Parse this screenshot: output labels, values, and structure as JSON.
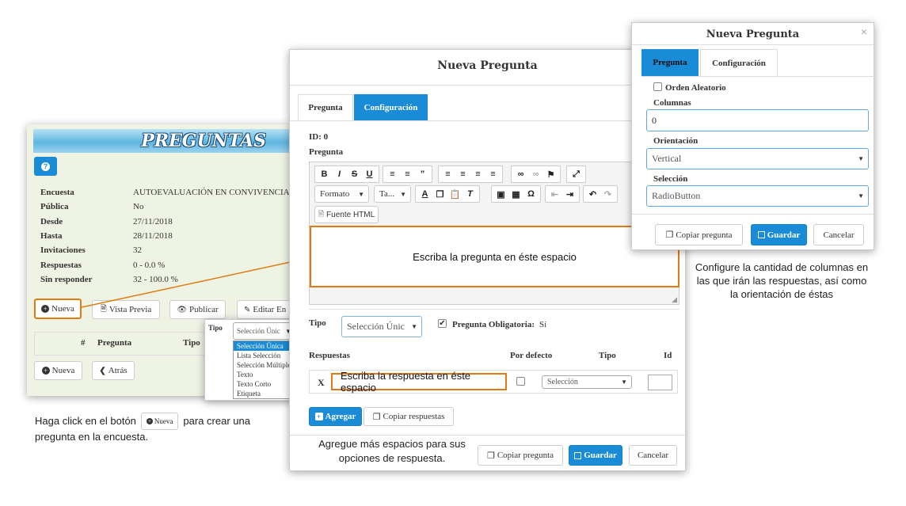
{
  "survey_panel": {
    "title": "PREGUNTAS",
    "help_label": "?",
    "rows": [
      {
        "label": "Encuesta",
        "value": "AUTOEVALUACIÓN EN CONVIVENCIA"
      },
      {
        "label": "Pública",
        "value": "No"
      },
      {
        "label": "Desde",
        "value": "27/11/2018"
      },
      {
        "label": "Hasta",
        "value": "28/11/2018"
      },
      {
        "label": "Invitaciones",
        "value": "32"
      },
      {
        "label": "Respuestas",
        "value": "0  -  0.0 %"
      },
      {
        "label": "Sin responder",
        "value": "32  -  100.0 %"
      }
    ],
    "buttons": {
      "nueva": "Nueva",
      "vista_previa": "Vista Previa",
      "publicar": "Publicar",
      "editar": "Editar En"
    },
    "table_headers": {
      "num": "#",
      "pregunta": "Pregunta",
      "tipo": "Tipo"
    },
    "bottom_buttons": {
      "nueva": "Nueva",
      "atras": "Atrás"
    }
  },
  "tipo_popup": {
    "label": "Tipo",
    "selected": "Selección Únic",
    "options": [
      "Selección Única",
      "Lista Selección",
      "Selección Múltiple",
      "Texto",
      "Texto Corto",
      "Etiqueta"
    ]
  },
  "caption_left": {
    "before": "Haga click en el botón",
    "button": "Nueva",
    "after1": "para crear una",
    "after2": "pregunta en la encuesta."
  },
  "main_modal": {
    "title": "Nueva Pregunta",
    "tabs": [
      "Pregunta",
      "Configuración"
    ],
    "id_label": "ID: 0",
    "pregunta_label": "Pregunta",
    "toolbar": {
      "formato": "Formato",
      "tamano": "Ta...",
      "fuente_html": "Fuente HTML"
    },
    "editor_text": "Escriba la pregunta en éste espacio",
    "tipo_label": "Tipo",
    "tipo_value": "Selección Únic",
    "obligatoria_label": "Pregunta Obligatoria:",
    "obligatoria_value": "Sí",
    "headers": {
      "respuestas": "Respuestas",
      "por_defecto": "Por defecto",
      "tipo": "Tipo",
      "id": "Id"
    },
    "answer_remove": "X",
    "answer_text": "Escriba la respuesta en éste espacio",
    "answer_type": "Selección",
    "buttons": {
      "agregar": "Agregar",
      "copiar_respuestas": "Copiar respuestas",
      "copiar_pregunta": "Copiar pregunta",
      "guardar": "Guardar",
      "cancelar": "Cancelar"
    }
  },
  "caption_middle": {
    "line1": "Agregue más espacios para sus",
    "line2": "opciones de respuesta."
  },
  "config_modal": {
    "title": "Nueva Pregunta",
    "close": "×",
    "tabs": [
      "Pregunta",
      "Configuración"
    ],
    "orden_label": "Orden Aleatorio",
    "columnas_label": "Columnas",
    "columnas_value": "0",
    "orientacion_label": "Orientación",
    "orientacion_value": "Vertical",
    "seleccion_label": "Selección",
    "seleccion_value": "RadioButton",
    "buttons": {
      "copiar_pregunta": "Copiar pregunta",
      "guardar": "Guardar",
      "cancelar": "Cancelar"
    }
  },
  "caption_right": {
    "line1": "Configure la cantidad de columnas en",
    "line2": "las que irán las respuestas, así como",
    "line3": "la orientación de éstas"
  },
  "colors": {
    "primary": "#1a8bd6",
    "orange": "#e07b12",
    "panel_bg": "#eef3e4"
  }
}
